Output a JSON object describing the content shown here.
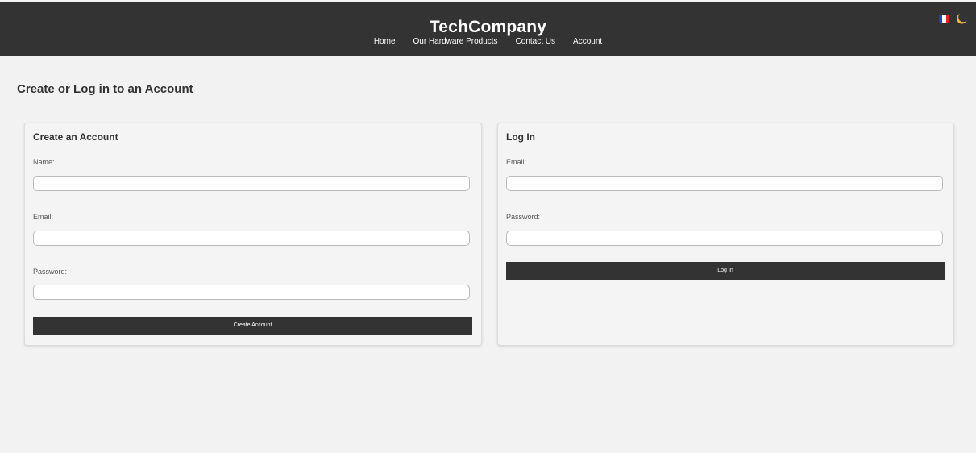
{
  "header": {
    "brand": "TechCompany",
    "nav": [
      "Home",
      "Our Hardware Products",
      "Contact Us",
      "Account"
    ],
    "icons": {
      "language": "french-flag-icon",
      "theme": "moon-icon"
    },
    "background": "#333333",
    "flag_colors": [
      "#1f3ec9",
      "#ffffff",
      "#e0252b"
    ],
    "moon_color": "#f2b531"
  },
  "page": {
    "title": "Create or Log in to an Account"
  },
  "create": {
    "heading": "Create an Account",
    "name_label": "Name:",
    "email_label": "Email:",
    "password_label": "Password:",
    "button": "Create Account"
  },
  "login": {
    "heading": "Log In",
    "email_label": "Email:",
    "password_label": "Password:",
    "button": "Log In"
  }
}
